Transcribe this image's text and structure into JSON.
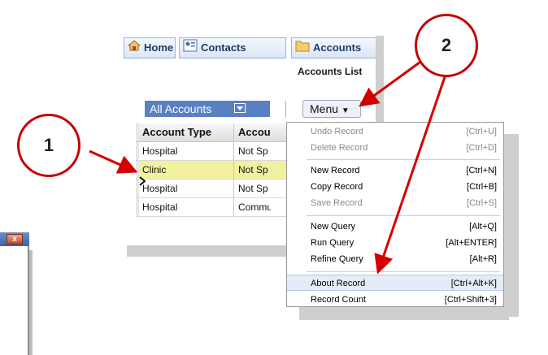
{
  "tabs": [
    {
      "label": "Home",
      "icon": "home-icon"
    },
    {
      "label": "Contacts",
      "icon": "contacts-icon"
    },
    {
      "label": "Accounts",
      "icon": "folder-icon"
    }
  ],
  "breadcrumb": "Accounts List",
  "filter": {
    "label": "All Accounts"
  },
  "menu_button": {
    "label": "Menu"
  },
  "grid": {
    "headers": [
      "Account Type",
      "Accou"
    ],
    "rows": [
      {
        "type": "Hospital",
        "status": "Not Sp"
      },
      {
        "type": "Clinic",
        "status": "Not Sp"
      },
      {
        "type": "Hospital",
        "status": "Not Sp"
      },
      {
        "type": "Hospital",
        "status": "Commu"
      }
    ]
  },
  "menu": {
    "items": [
      {
        "label": "Undo Record",
        "shortcut": "[Ctrl+U]"
      },
      {
        "label": "Delete Record",
        "shortcut": "[Ctrl+D]"
      },
      {
        "label": "New Record",
        "shortcut": "[Ctrl+N]"
      },
      {
        "label": "Copy Record",
        "shortcut": "[Ctrl+B]"
      },
      {
        "label": "Save Record",
        "shortcut": "[Ctrl+S]"
      },
      {
        "label": "New Query",
        "shortcut": "[Alt+Q]"
      },
      {
        "label": "Run Query",
        "shortcut": "[Alt+ENTER]"
      },
      {
        "label": "Refine Query",
        "shortcut": "[Alt+R]"
      },
      {
        "label": "About Record",
        "shortcut": "[Ctrl+Alt+K]"
      },
      {
        "label": "Record Count",
        "shortcut": "[Ctrl+Shift+3]"
      }
    ]
  },
  "callouts": {
    "one": "1",
    "two": "2"
  },
  "window_close": "x",
  "colors": {
    "callout": "#c40000",
    "selected_row": "#f1f1a0",
    "filter_bg": "#5b80c0"
  }
}
